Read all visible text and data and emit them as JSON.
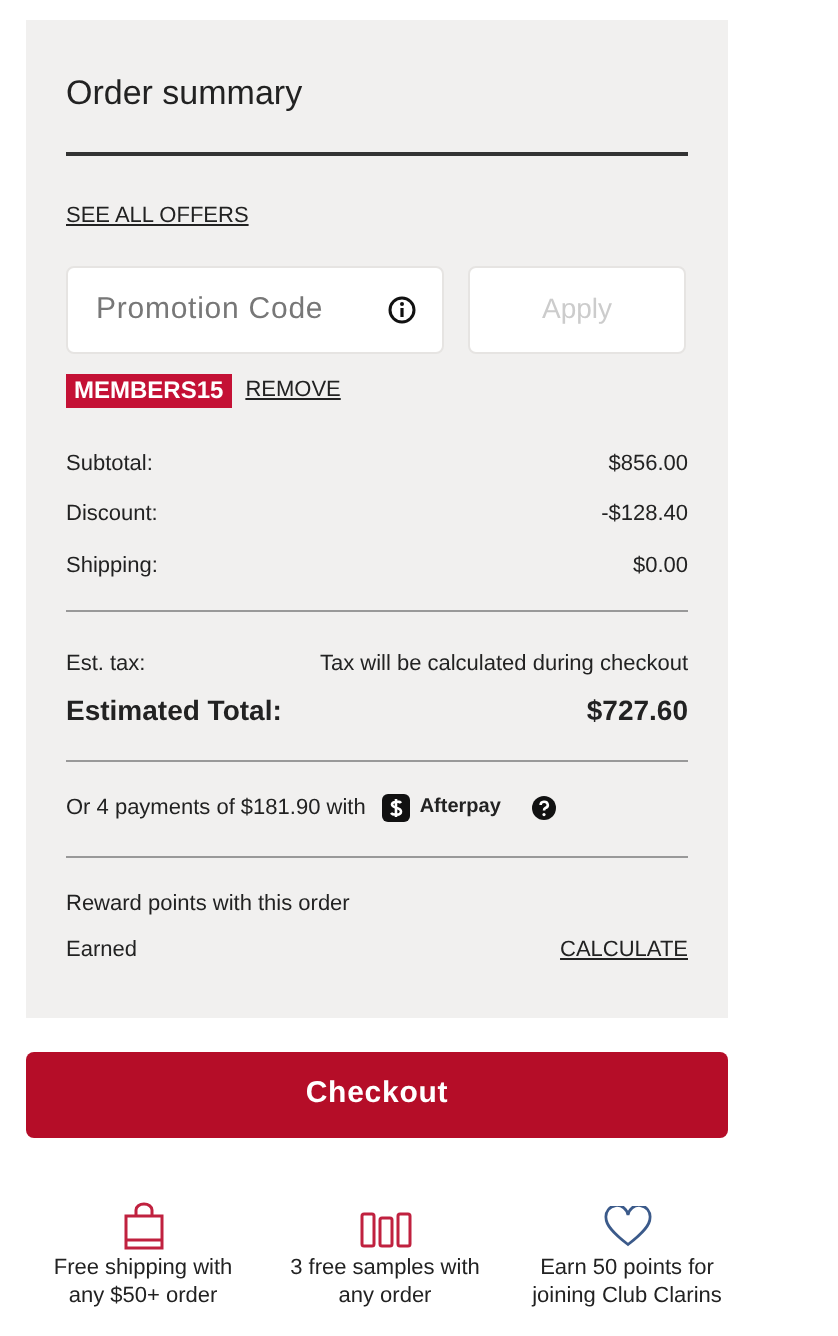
{
  "summary": {
    "title": "Order summary",
    "offers_link": "SEE ALL OFFERS",
    "promo": {
      "placeholder": "Promotion Code",
      "apply": "Apply",
      "apply_disabled": true
    },
    "applied_code": {
      "code": "MEMBERS15",
      "remove": "REMOVE"
    },
    "lines": [
      {
        "label": "Subtotal:",
        "value": "$856.00"
      },
      {
        "label": "Discount:",
        "value": "-$128.40"
      },
      {
        "label": "Shipping:",
        "value": "$0.00"
      }
    ],
    "tax": {
      "label": "Est. tax:",
      "value": "Tax will be calculated during checkout"
    },
    "total": {
      "label": "Estimated Total:",
      "value": "$727.60"
    },
    "installments": {
      "text": "Or 4 payments of $181.90 with",
      "provider": "Afterpay"
    },
    "rewards": {
      "title": "Reward points with this order",
      "label": "Earned",
      "link": "CALCULATE"
    }
  },
  "checkout": "Checkout",
  "perks": [
    {
      "kind": "bag",
      "text": "Free shipping with any $50+ order"
    },
    {
      "kind": "samples",
      "text": "3 free samples with any order"
    },
    {
      "kind": "heart",
      "text": "Earn 50 points for joining Club Clarins"
    }
  ]
}
